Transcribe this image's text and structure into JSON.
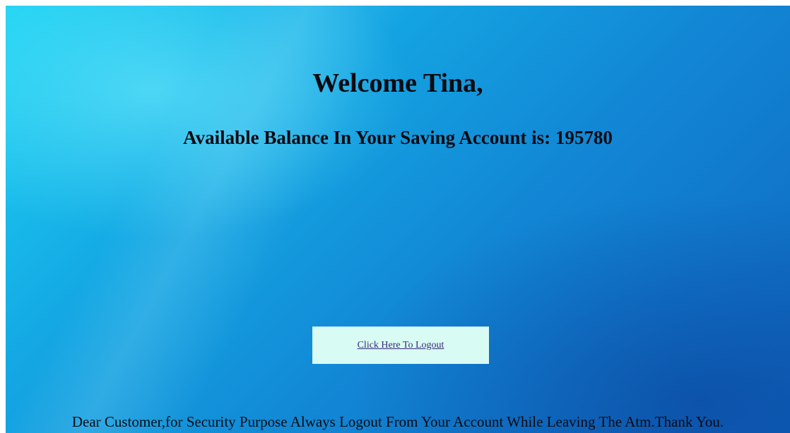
{
  "page": {
    "welcome_text": "Welcome Tina,",
    "balance_text": "Available Balance In Your Saving Account is: 195780",
    "logout_label": "Click Here To Logout",
    "notice_text": "Dear Customer,for Security Purpose Always Logout From Your Account While Leaving The Atm.Thank You."
  },
  "colors": {
    "background_light": "#1ed3f3",
    "background_dark": "#0f66bf",
    "logout_box": "#d8fbf3",
    "link": "#3a2a78",
    "text": "#0b0b12"
  }
}
